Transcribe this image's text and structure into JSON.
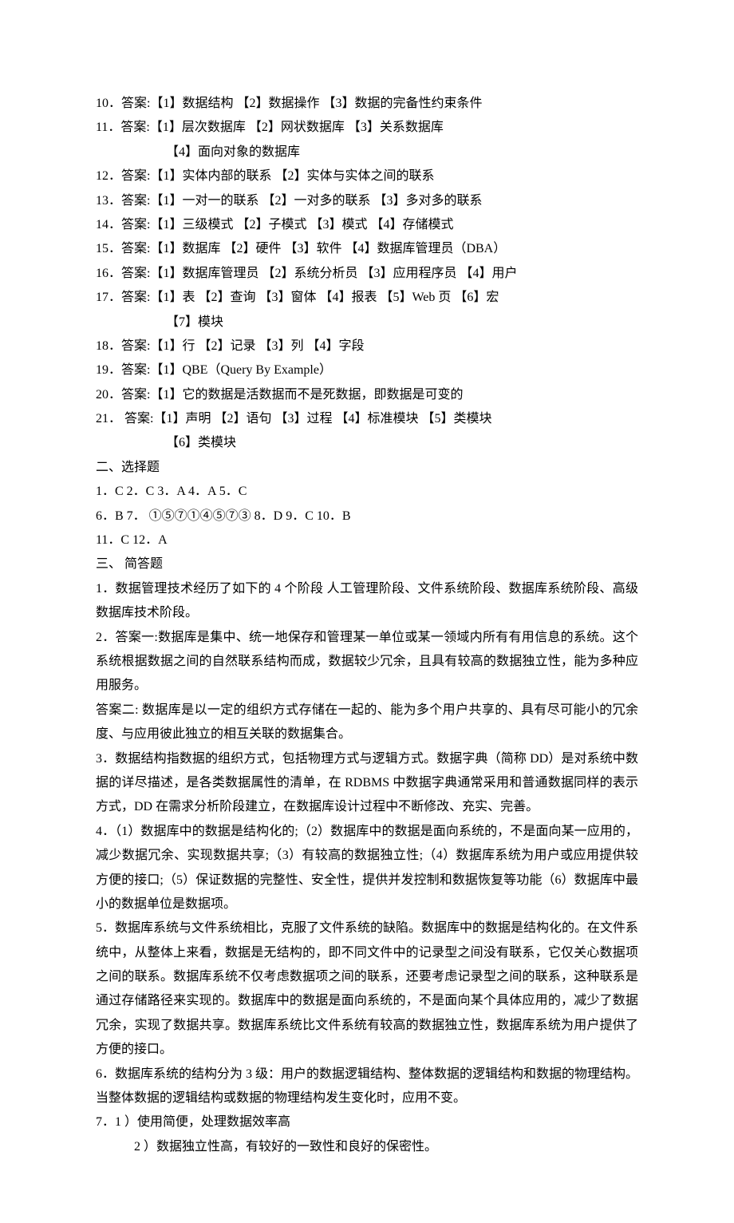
{
  "lines": [
    {
      "text": "10．答案:【1】数据结构    【2】数据操作    【3】数据的完备性约束条件"
    },
    {
      "text": "11．答案:【1】层次数据库  【2】网状数据库  【3】关系数据库"
    },
    {
      "text": "【4】面向对象的数据库",
      "class": "indent"
    },
    {
      "text": "12．答案:【1】实体内部的联系    【2】实体与实体之间的联系"
    },
    {
      "text": "13．答案:【1】一对一的联系  【2】一对多的联系  【3】多对多的联系"
    },
    {
      "text": "14．答案:【1】三级模式  【2】子模式  【3】模式  【4】存储模式"
    },
    {
      "text": "15．答案:【1】数据库  【2】硬件  【3】软件  【4】数据库管理员（DBA）"
    },
    {
      "text": "16．答案:【1】数据库管理员  【2】系统分析员  【3】应用程序员  【4】用户"
    },
    {
      "text": "17．答案:【1】表  【2】查询  【3】窗体  【4】报表  【5】Web 页  【6】宏"
    },
    {
      "text": "【7】模块",
      "class": "indent"
    },
    {
      "text": "18．答案:【1】行  【2】记录  【3】列  【4】字段"
    },
    {
      "text": "19．答案:【1】QBE（Query By Example）"
    },
    {
      "text": "20．答案:【1】它的数据是活数据而不是死数据，即数据是可变的"
    },
    {
      "text": "21． 答案:【1】声明  【2】语句    【3】过程  【4】标准模块  【5】类模块"
    },
    {
      "text": "【6】类模块",
      "class": "indent"
    },
    {
      "text": "二、选择题"
    },
    {
      "text": "1．C   2．C     3．A     4．A     5．C"
    },
    {
      "text": "6．B   7．    ①⑤⑦①④⑤⑦③    8．D      9．C    10．B"
    },
    {
      "text": "11．C    12．A"
    },
    {
      "text": "三、 简答题"
    },
    {
      "text": "1．数据管理技术经历了如下的 4 个阶段  人工管理阶段、文件系统阶段、数据库系统阶段、高级数据库技术阶段。"
    },
    {
      "text": "2．答案一:数据库是集中、统一地保存和管理某一单位或某一领域内所有有用信息的系统。这个系统根据数据之间的自然联系结构而成，数据较少冗余，且具有较高的数据独立性，能为多种应用服务。"
    },
    {
      "text": "答案二: 数据库是以一定的组织方式存储在一起的、能为多个用户共享的、具有尽可能小的冗余度、与应用彼此独立的相互关联的数据集合。"
    },
    {
      "text": "3．数据结构指数据的组织方式，包括物理方式与逻辑方式。数据字典（简称 DD）是对系统中数据的详尽描述，是各类数据属性的清单，在 RDBMS 中数据字典通常采用和普通数据同样的表示方式，DD 在需求分析阶段建立，在数据库设计过程中不断修改、充实、完善。"
    },
    {
      "text": "4．（1）数据库中的数据是结构化的;（2）数据库中的数据是面向系统的，不是面向某一应用的，减少数据冗余、实现数据共享;（3）有较高的数据独立性;（4）数据库系统为用户或应用提供较方便的接口;（5）保证数据的完整性、安全性，提供并发控制和数据恢复等功能（6）数据库中最小的数据单位是数据项。"
    },
    {
      "text": "5．数据库系统与文件系统相比，克服了文件系统的缺陷。数据库中的数据是结构化的。在文件系统中，从整体上来看，数据是无结构的，即不同文件中的记录型之间没有联系，它仅关心数据项之间的联系。数据库系统不仅考虑数据项之间的联系，还要考虑记录型之间的联系，这种联系是通过存储路径来实现的。数据库中的数据是面向系统的，不是面向某个具体应用的，减少了数据冗余，实现了数据共享。数据库系统比文件系统有较高的数据独立性，数据库系统为用户提供了方便的接口。"
    },
    {
      "text": "6．数据库系统的结构分为 3 级：用户的数据逻辑结构、整体数据的逻辑结构和数据的物理结构。当整体数据的逻辑结构或数据的物理结构发生变化时，应用不变。"
    },
    {
      "text": "7．1 ）使用简便，处理数据效率高"
    },
    {
      "text": "2 ）数据独立性高，有较好的一致性和良好的保密性。",
      "class": "indent2"
    }
  ]
}
